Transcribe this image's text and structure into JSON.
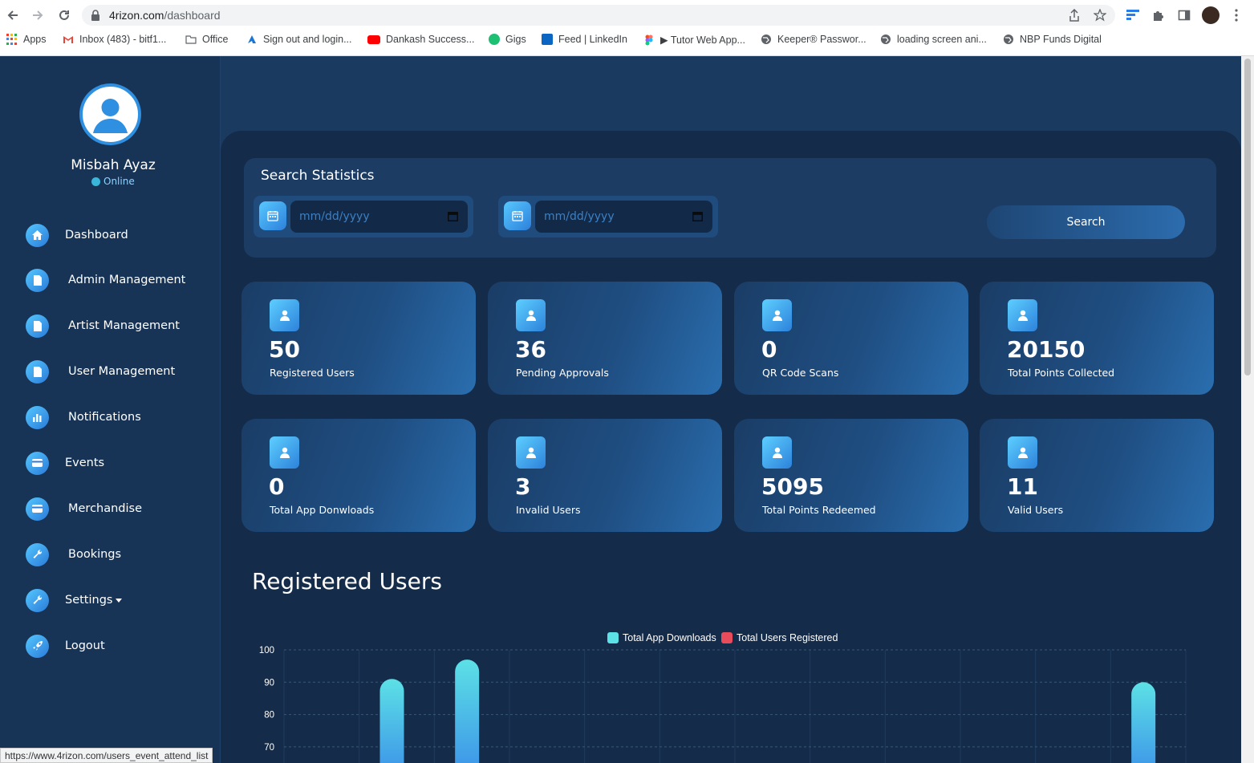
{
  "browser": {
    "url_host": "4rizon.com",
    "url_path": "/dashboard",
    "bookmarks": [
      {
        "label": "Apps",
        "icon": "apps-grid-icon"
      },
      {
        "label": "Inbox (483) - bitf1...",
        "icon": "gmail-icon"
      },
      {
        "label": "Office",
        "icon": "folder-icon"
      },
      {
        "label": "Sign out and login...",
        "icon": "azure-icon"
      },
      {
        "label": "Dankash Success...",
        "icon": "youtube-icon"
      },
      {
        "label": "Gigs",
        "icon": "fiverr-icon"
      },
      {
        "label": "Feed | LinkedIn",
        "icon": "linkedin-icon"
      },
      {
        "label": "▶ Tutor Web App...",
        "icon": "figma-icon"
      },
      {
        "label": "Keeper® Passwor...",
        "icon": "globe-icon"
      },
      {
        "label": "loading screen ani...",
        "icon": "globe-icon"
      },
      {
        "label": "NBP Funds Digital",
        "icon": "globe-icon"
      }
    ],
    "status_url": "https://www.4rizon.com/users_event_attend_list"
  },
  "profile": {
    "name": "Misbah Ayaz",
    "status": "Online"
  },
  "sidebar": {
    "items": [
      {
        "label": "Dashboard",
        "icon": "home-icon"
      },
      {
        "label": "Admin Management",
        "icon": "document-icon"
      },
      {
        "label": "Artist Management",
        "icon": "document-icon"
      },
      {
        "label": "User Management",
        "icon": "document-icon"
      },
      {
        "label": "Notifications",
        "icon": "bar-chart-icon"
      },
      {
        "label": "Events",
        "icon": "card-icon"
      },
      {
        "label": "Merchandise",
        "icon": "card-icon"
      },
      {
        "label": "Bookings",
        "icon": "wrench-icon"
      },
      {
        "label": "Settings",
        "icon": "wrench-icon"
      },
      {
        "label": "Logout",
        "icon": "rocket-icon"
      }
    ]
  },
  "search": {
    "title": "Search Statistics",
    "start_placeholder": "mm/dd/yyyy",
    "end_placeholder": "mm/dd/yyyy",
    "button_label": "Search"
  },
  "stats": [
    {
      "value": "50",
      "label": "Registered Users"
    },
    {
      "value": "36",
      "label": "Pending Approvals"
    },
    {
      "value": "0",
      "label": "QR Code Scans"
    },
    {
      "value": "20150",
      "label": "Total Points Collected"
    },
    {
      "value": "0",
      "label": "Total App Donwloads"
    },
    {
      "value": "3",
      "label": "Invalid Users"
    },
    {
      "value": "5095",
      "label": "Total Points Redeemed"
    },
    {
      "value": "11",
      "label": "Valid Users"
    }
  ],
  "chart_section": {
    "title": "Registered Users"
  },
  "colors": {
    "accent": "#2f8fe0",
    "downloads": "#5ce1e6",
    "registered": "#e84c5a",
    "sidebar": "#173457",
    "panel": "#142b4a"
  },
  "chart_data": {
    "type": "bar",
    "legend": [
      "Total App Downloads",
      "Total Users Registered"
    ],
    "legend_position": "top-center",
    "y_ticks": [
      "100",
      "90",
      "80",
      "70"
    ],
    "ylim": [
      70,
      100
    ],
    "grid": true,
    "visible_bars": [
      {
        "category_index": 1,
        "value": 91
      },
      {
        "category_index": 2,
        "value": 97
      },
      {
        "category_index": 11,
        "value": 90
      }
    ]
  }
}
